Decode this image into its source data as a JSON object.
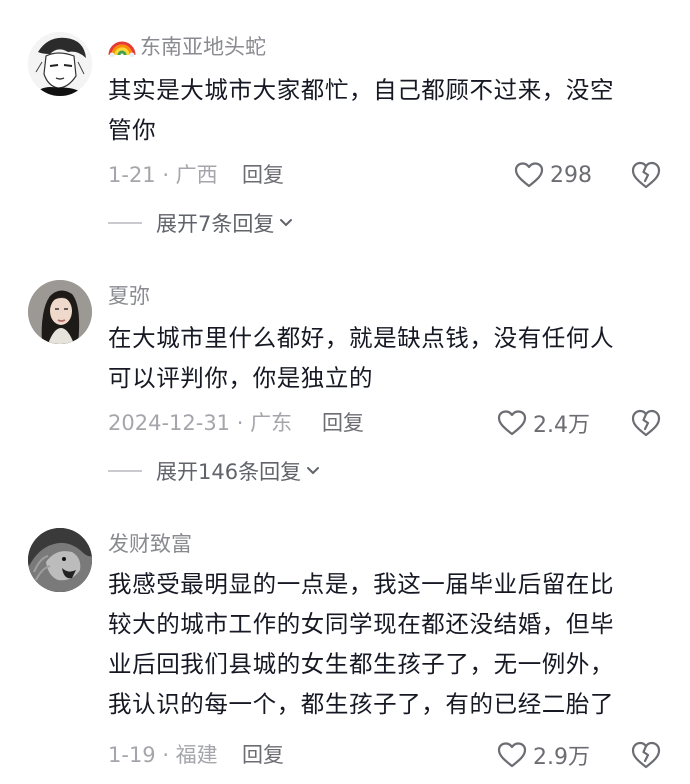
{
  "comments": [
    {
      "username": "东南亚地头蛇",
      "has_rainbow_emoji": true,
      "avatar": "sketch-portrait-avatar",
      "lines": [
        "其实是大城市大家都忙，自己都顾不过来，没空",
        "管你"
      ],
      "meta": "1-21 · 广西",
      "reply_label": "回复",
      "likes": "298",
      "expand_label": "展开7条回复"
    },
    {
      "username": "夏弥",
      "has_rainbow_emoji": false,
      "avatar": "woman-photo-avatar",
      "lines": [
        "在大城市里什么都好，就是缺点钱，没有任何人",
        "可以评判你，你是独立的"
      ],
      "meta": "2024-12-31 · 广东",
      "reply_label": "回复",
      "likes": "2.4万",
      "expand_label": "展开146条回复"
    },
    {
      "username": "发财致富",
      "has_rainbow_emoji": false,
      "avatar": "lion-photo-avatar",
      "lines": [
        "我感受最明显的一点是，我这一届毕业后留在比",
        "较大的城市工作的女同学现在都还没结婚，但毕",
        "业后回我们县城的女生都生孩子了，无一例外，",
        "我认识的每一个，都生孩子了，有的已经二胎了"
      ],
      "meta": "1-19 · 福建",
      "reply_label": "回复",
      "likes": "2.9万"
    }
  ],
  "icons": {
    "like": "heart-outline-icon",
    "dislike": "broken-heart-icon",
    "expand": "chevron-down-icon",
    "emoji": "rainbow-emoji-icon"
  },
  "colors": {
    "text": "#161823",
    "username": "#8a8b91",
    "meta": "#a5a6ab",
    "secondary": "#6c6d73"
  }
}
